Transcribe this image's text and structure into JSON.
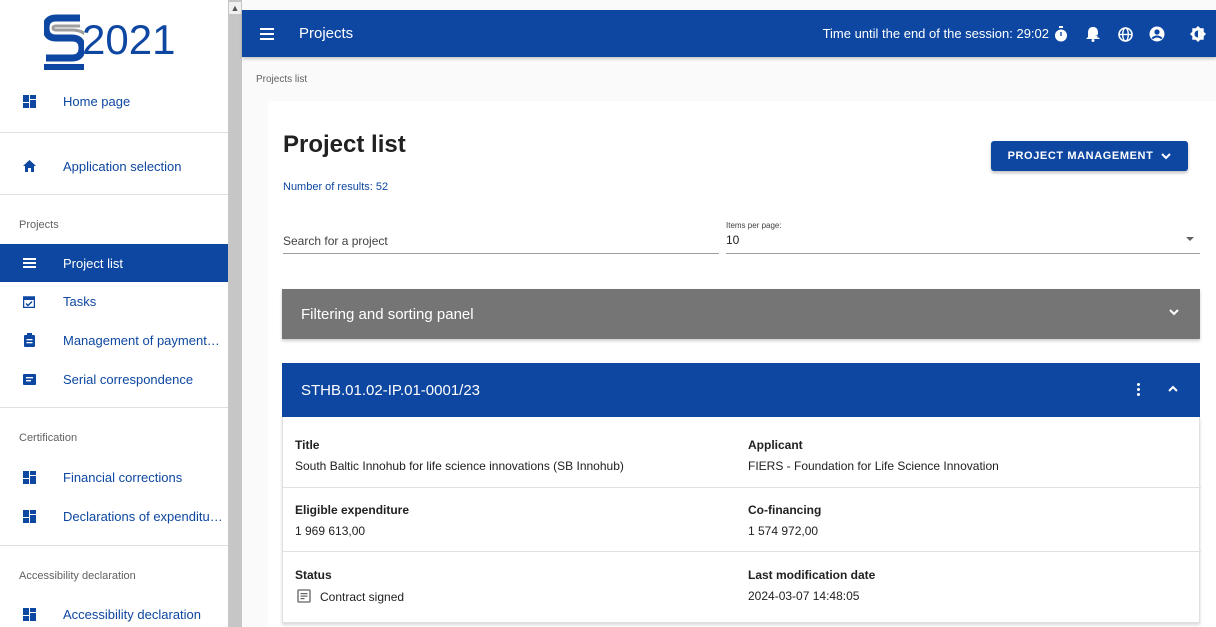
{
  "logo": {
    "text": "2021"
  },
  "sidebar": {
    "items": [
      {
        "label": "Home page",
        "icon": "dashboard-icon"
      },
      {
        "label": "Application selection",
        "icon": "home-icon"
      },
      {
        "label": "Project list",
        "icon": "list-icon",
        "active": true
      },
      {
        "label": "Tasks",
        "icon": "calendar-check-icon"
      },
      {
        "label": "Management of payment…",
        "icon": "clipboard-icon"
      },
      {
        "label": "Serial correspondence",
        "icon": "mail-icon"
      },
      {
        "label": "Financial corrections",
        "icon": "dashboard-icon"
      },
      {
        "label": "Declarations of expenditu…",
        "icon": "dashboard-icon"
      },
      {
        "label": "Accessibility declaration",
        "icon": "dashboard-icon"
      }
    ],
    "sections": {
      "projects": "Projects",
      "certification": "Certification",
      "accessibility": "Accessibility declaration"
    }
  },
  "topbar": {
    "title": "Projects",
    "session": "Time until the end of the session: 29:02"
  },
  "breadcrumb": "Projects list",
  "main": {
    "title": "Project list",
    "results": "Number of results: 52",
    "pm_button": "PROJECT MANAGEMENT",
    "search_placeholder": "Search for a project",
    "items_per_page_label": "Items per page:",
    "items_per_page_value": "10",
    "filter_panel": "Filtering and sorting panel"
  },
  "project": {
    "number": "STHB.01.02-IP.01-0001/23",
    "title_label": "Title",
    "title_value": "South Baltic Innohub for life science innovations (SB Innohub)",
    "applicant_label": "Applicant",
    "applicant_value": "FIERS - Foundation for Life Science Innovation",
    "expenditure_label": "Eligible expenditure",
    "expenditure_value": "1 969 613,00",
    "cofinancing_label": "Co-financing",
    "cofinancing_value": "1 574 972,00",
    "status_label": "Status",
    "status_value": "Contract signed",
    "modified_label": "Last modification date",
    "modified_value": "2024-03-07 14:48:05"
  },
  "colors": {
    "primary": "#0d47a1",
    "filter_bg": "#757575"
  }
}
